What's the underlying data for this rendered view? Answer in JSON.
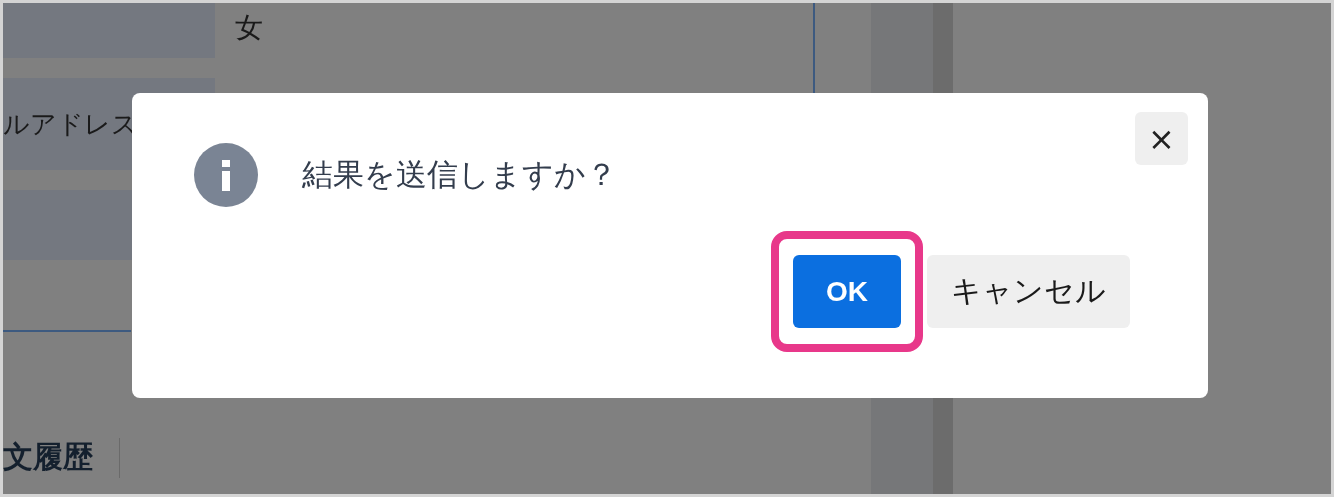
{
  "background_form": {
    "rows": [
      {
        "label": "",
        "value": "女"
      },
      {
        "label": "ルアドレス",
        "value": ""
      },
      {
        "label": "",
        "value": ""
      }
    ],
    "section_title": "文履歴"
  },
  "dialog": {
    "message": "結果を送信しますか？",
    "close_label": "×",
    "buttons": [
      {
        "label": "OK",
        "kind": "primary",
        "highlighted": true
      },
      {
        "label": "キャンセル",
        "kind": "secondary",
        "highlighted": false
      }
    ]
  }
}
